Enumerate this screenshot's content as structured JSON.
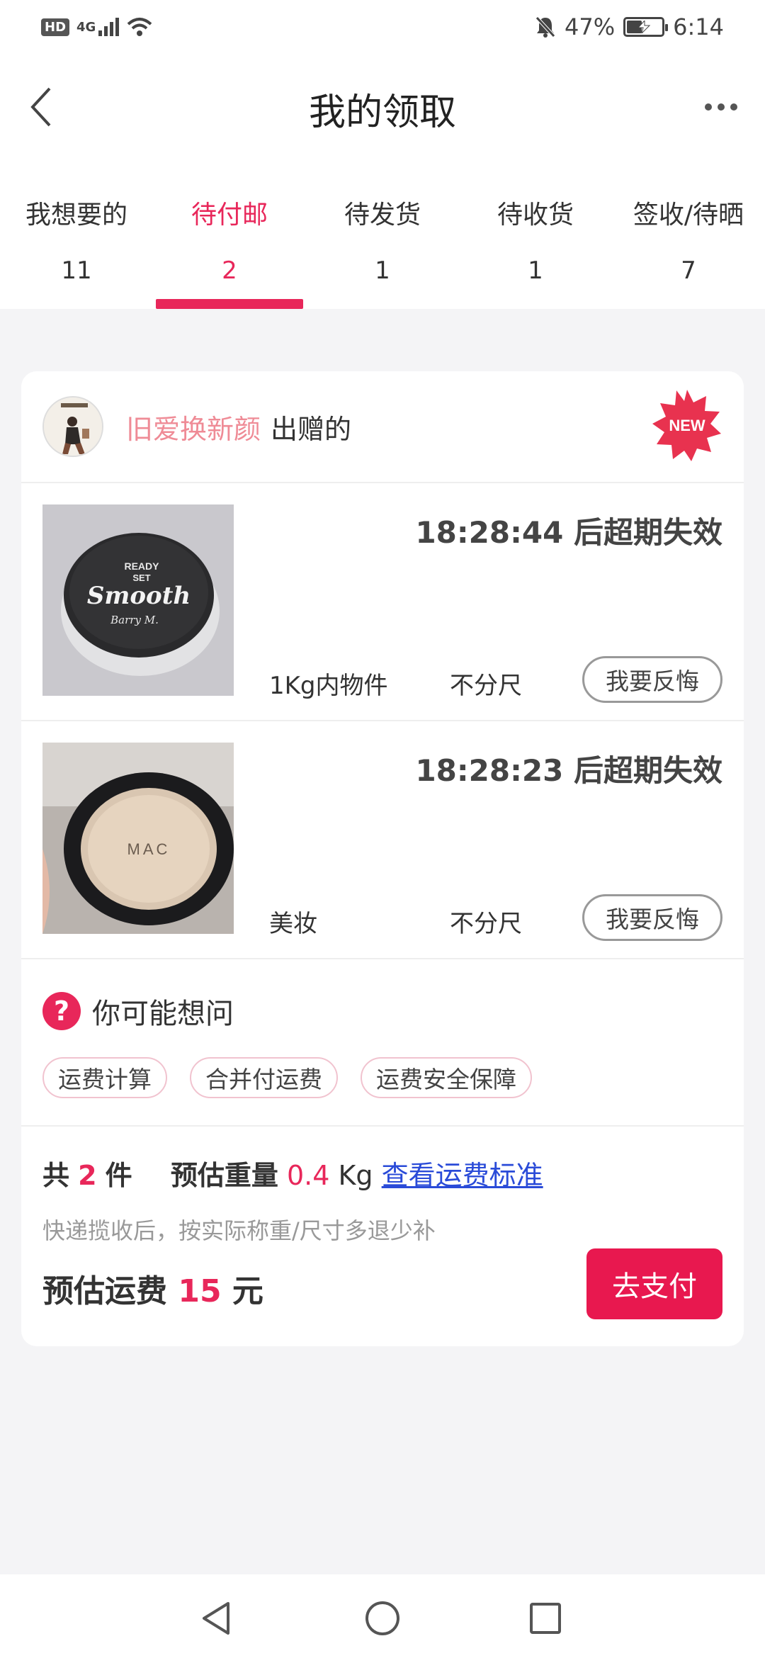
{
  "status_bar": {
    "hd": "HD",
    "network": "4G",
    "battery_percent": "47%",
    "battery_level": 0.47,
    "time": "6:14"
  },
  "header": {
    "title": "我的领取"
  },
  "tabs": [
    {
      "label": "我想要的",
      "count": "11"
    },
    {
      "label": "待付邮",
      "count": "2"
    },
    {
      "label": "待发货",
      "count": "1"
    },
    {
      "label": "待收货",
      "count": "1"
    },
    {
      "label": "签收/待晒",
      "count": "7"
    }
  ],
  "active_tab": 1,
  "giver": {
    "name": "旧爱换新颜",
    "suffix": "出赠的",
    "badge": "NEW"
  },
  "items": [
    {
      "timer": "18:28:44 后超期失效",
      "category": "1Kg内物件",
      "size": "不分尺",
      "action": "我要反悔",
      "thumb_text": [
        "READY",
        "SET",
        "Smooth",
        "Barry M."
      ]
    },
    {
      "timer": "18:28:23 后超期失效",
      "category": "美妆",
      "size": "不分尺",
      "action": "我要反悔",
      "thumb_text": [
        "MAC"
      ]
    }
  ],
  "faq": {
    "icon": "?",
    "title": "你可能想问",
    "tags": [
      "运费计算",
      "合并付运费",
      "运费安全保障"
    ]
  },
  "summary": {
    "total_prefix": "共",
    "total_count": "2",
    "total_unit": "件",
    "weight_label": "预估重量",
    "weight_value": "0.4",
    "weight_unit": "Kg",
    "fee_link": "查看运费标准",
    "note": "快递揽收后，按实际称重/尺寸多退少补",
    "fee_label": "预估运费",
    "fee_value": "15",
    "fee_unit": "元",
    "pay_button": "去支付"
  },
  "colors": {
    "accent": "#e8275a",
    "pay_button": "#e8184f",
    "giver_name": "#ef8b96",
    "link": "#2a4bd8"
  }
}
